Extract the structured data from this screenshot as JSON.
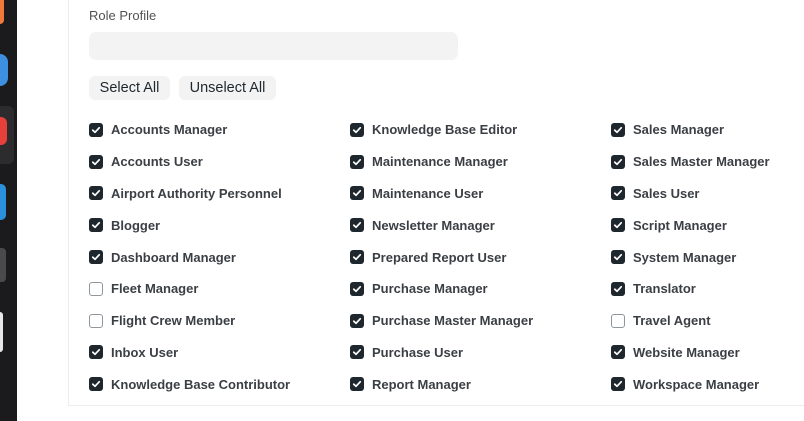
{
  "form": {
    "role_profile_label": "Role Profile",
    "role_profile_value": "",
    "select_all_label": "Select All",
    "unselect_all_label": "Unselect All"
  },
  "roles": {
    "col1": [
      {
        "label": "Accounts Manager",
        "checked": true
      },
      {
        "label": "Accounts User",
        "checked": true
      },
      {
        "label": "Airport Authority Personnel",
        "checked": true
      },
      {
        "label": "Blogger",
        "checked": true
      },
      {
        "label": "Dashboard Manager",
        "checked": true
      },
      {
        "label": "Fleet Manager",
        "checked": false
      },
      {
        "label": "Flight Crew Member",
        "checked": false
      },
      {
        "label": "Inbox User",
        "checked": true
      },
      {
        "label": "Knowledge Base Contributor",
        "checked": true
      }
    ],
    "col2": [
      {
        "label": "Knowledge Base Editor",
        "checked": true
      },
      {
        "label": "Maintenance Manager",
        "checked": true
      },
      {
        "label": "Maintenance User",
        "checked": true
      },
      {
        "label": "Newsletter Manager",
        "checked": true
      },
      {
        "label": "Prepared Report User",
        "checked": true
      },
      {
        "label": "Purchase Manager",
        "checked": true
      },
      {
        "label": "Purchase Master Manager",
        "checked": true
      },
      {
        "label": "Purchase User",
        "checked": true
      },
      {
        "label": "Report Manager",
        "checked": true
      }
    ],
    "col3": [
      {
        "label": "Sales Manager",
        "checked": true
      },
      {
        "label": "Sales Master Manager",
        "checked": true
      },
      {
        "label": "Sales User",
        "checked": true
      },
      {
        "label": "Script Manager",
        "checked": true
      },
      {
        "label": "System Manager",
        "checked": true
      },
      {
        "label": "Translator",
        "checked": true
      },
      {
        "label": "Travel Agent",
        "checked": false
      },
      {
        "label": "Website Manager",
        "checked": true
      },
      {
        "label": "Workspace Manager",
        "checked": true
      }
    ]
  },
  "colors": {
    "checkbox_checked": "#1f272e",
    "input_background": "#f3f3f3",
    "dock_background": "#1b1b1d"
  }
}
